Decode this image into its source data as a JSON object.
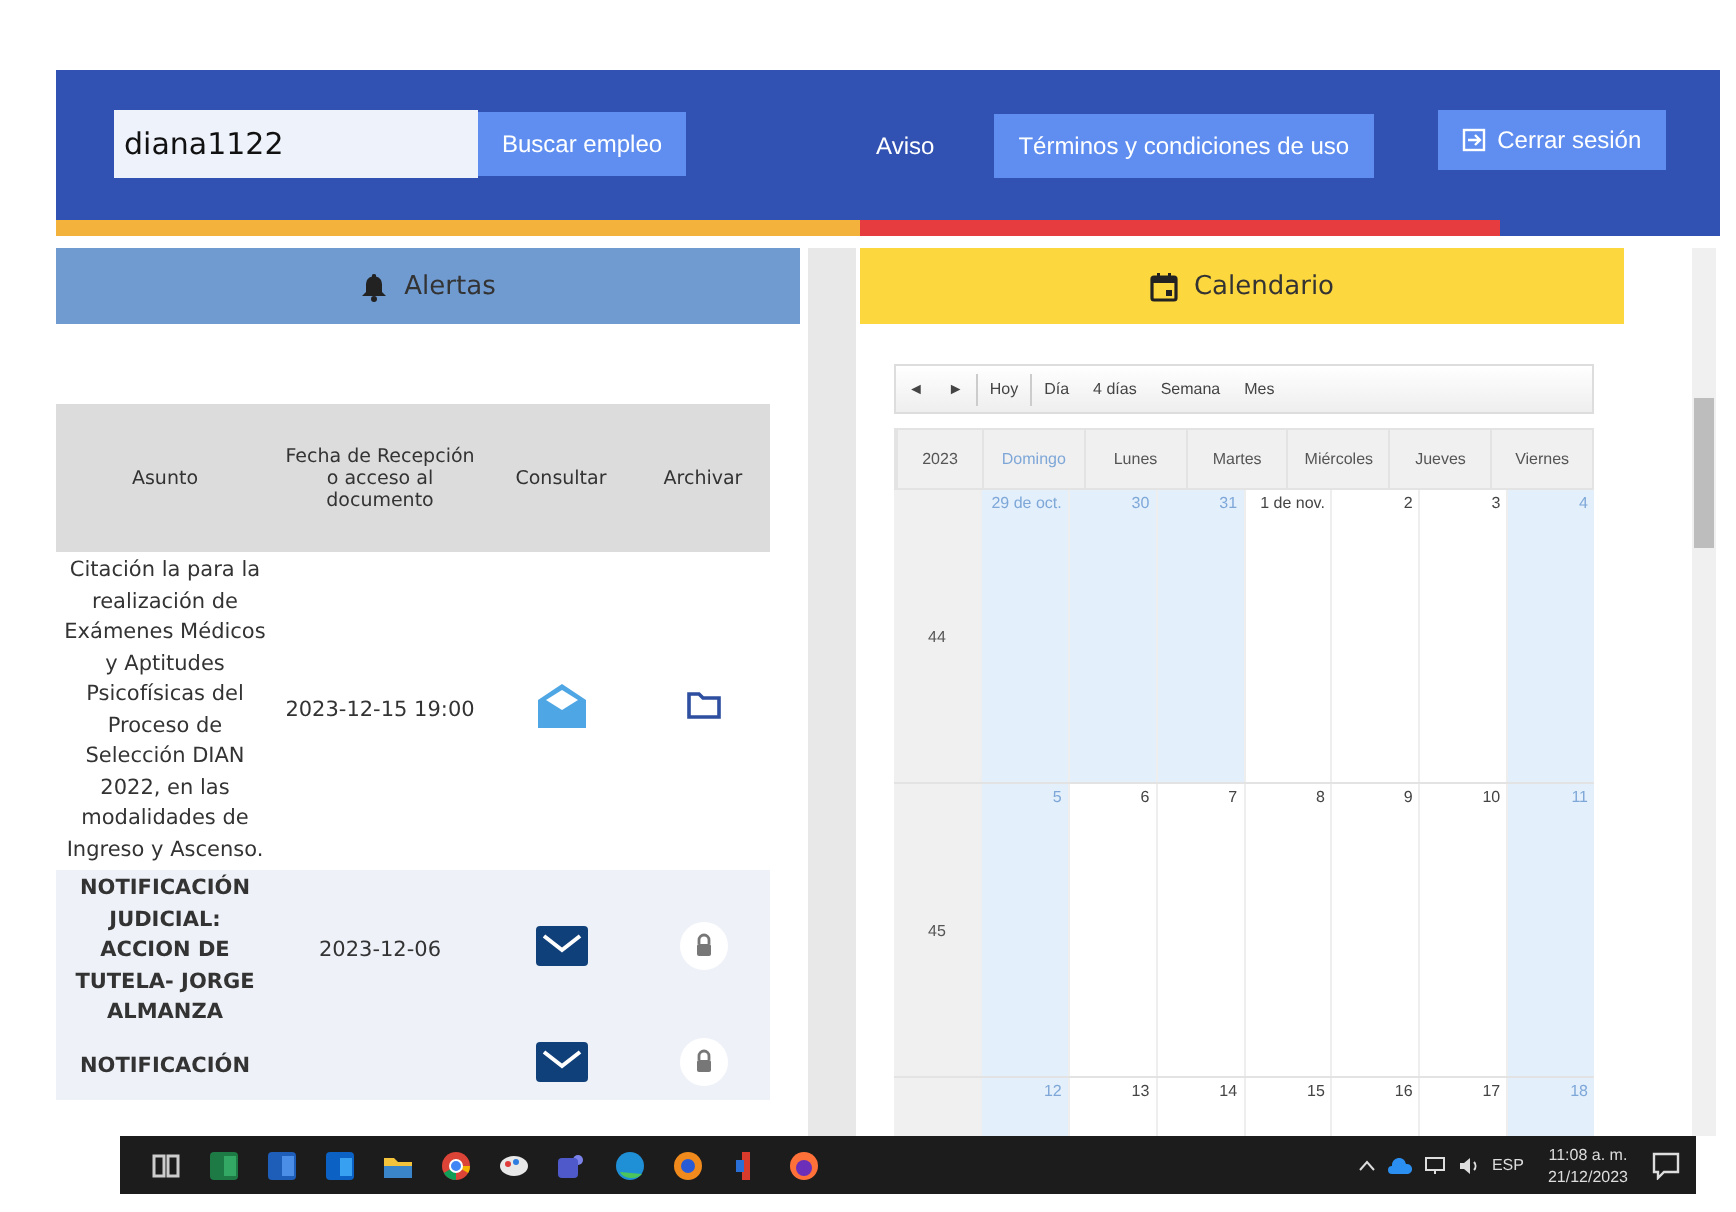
{
  "header": {
    "search": {
      "value": "diana1122"
    },
    "search_button": "Buscar empleo",
    "notice_link": "Aviso",
    "terms_button": "Términos y condiciones de uso",
    "logout_button": "Cerrar sesión"
  },
  "alerts": {
    "title": "Alertas",
    "columns": [
      "Asunto",
      "Fecha de Recepción o acceso al documento",
      "Consultar",
      "Archivar"
    ],
    "rows": [
      {
        "subject": "Citación la para la realización de Exámenes Médicos y Aptitudes Psicofísicas del Proceso de Selección DIAN 2022, en las modalidades de Ingreso y Ascenso.",
        "date": "2023-12-15 19:00",
        "read": true,
        "locked": false
      },
      {
        "subject": "NOTIFICACIÓN JUDICIAL: ACCION DE TUTELA- JORGE ALMANZA",
        "date": "2023-12-06",
        "read": false,
        "locked": true
      },
      {
        "subject": "NOTIFICACIÓN",
        "read": false,
        "locked": true
      }
    ]
  },
  "calendar": {
    "title": "Calendario",
    "nav": [
      "◄",
      "►"
    ],
    "today_button": "Hoy",
    "views": [
      "Día",
      "4 días",
      "Semana",
      "Mes"
    ],
    "year": "2023",
    "weekdays": [
      "Domingo",
      "Lunes",
      "Martes",
      "Miércoles",
      "Jueves",
      "Viernes"
    ],
    "weeks": [
      {
        "number": "44",
        "days": [
          {
            "label": "29 de oct.",
            "highlighted": true
          },
          {
            "label": "30",
            "highlighted": true
          },
          {
            "label": "31",
            "highlighted": true
          },
          {
            "label": "1 de nov.",
            "highlighted": false
          },
          {
            "label": "2",
            "highlighted": false
          },
          {
            "label": "3",
            "highlighted": false
          },
          {
            "label": "4",
            "highlighted": true
          }
        ]
      },
      {
        "number": "45",
        "days": [
          {
            "label": "5",
            "highlighted": true
          },
          {
            "label": "6",
            "highlighted": false
          },
          {
            "label": "7",
            "highlighted": false
          },
          {
            "label": "8",
            "highlighted": false
          },
          {
            "label": "9",
            "highlighted": false
          },
          {
            "label": "10",
            "highlighted": false
          },
          {
            "label": "11",
            "highlighted": true
          }
        ]
      },
      {
        "days": [
          {
            "label": "12",
            "highlighted": true
          },
          {
            "label": "13",
            "highlighted": false
          },
          {
            "label": "14",
            "highlighted": false
          },
          {
            "label": "15",
            "highlighted": false
          },
          {
            "label": "16",
            "highlighted": false
          },
          {
            "label": "17",
            "highlighted": false
          },
          {
            "label": "18",
            "highlighted": true
          }
        ]
      }
    ]
  },
  "taskbar": {
    "apps": [
      {
        "kind": "taskview"
      },
      {
        "kind": "sheet"
      },
      {
        "kind": "doc"
      },
      {
        "kind": "mail"
      },
      {
        "kind": "folder"
      },
      {
        "kind": "chrome"
      },
      {
        "kind": "paint"
      },
      {
        "kind": "team"
      },
      {
        "kind": "edge"
      },
      {
        "kind": "orb"
      },
      {
        "kind": "tool"
      },
      {
        "kind": "fox"
      }
    ],
    "language": "ESP",
    "time": "11:08 a. m.",
    "date": "21/12/2023"
  }
}
